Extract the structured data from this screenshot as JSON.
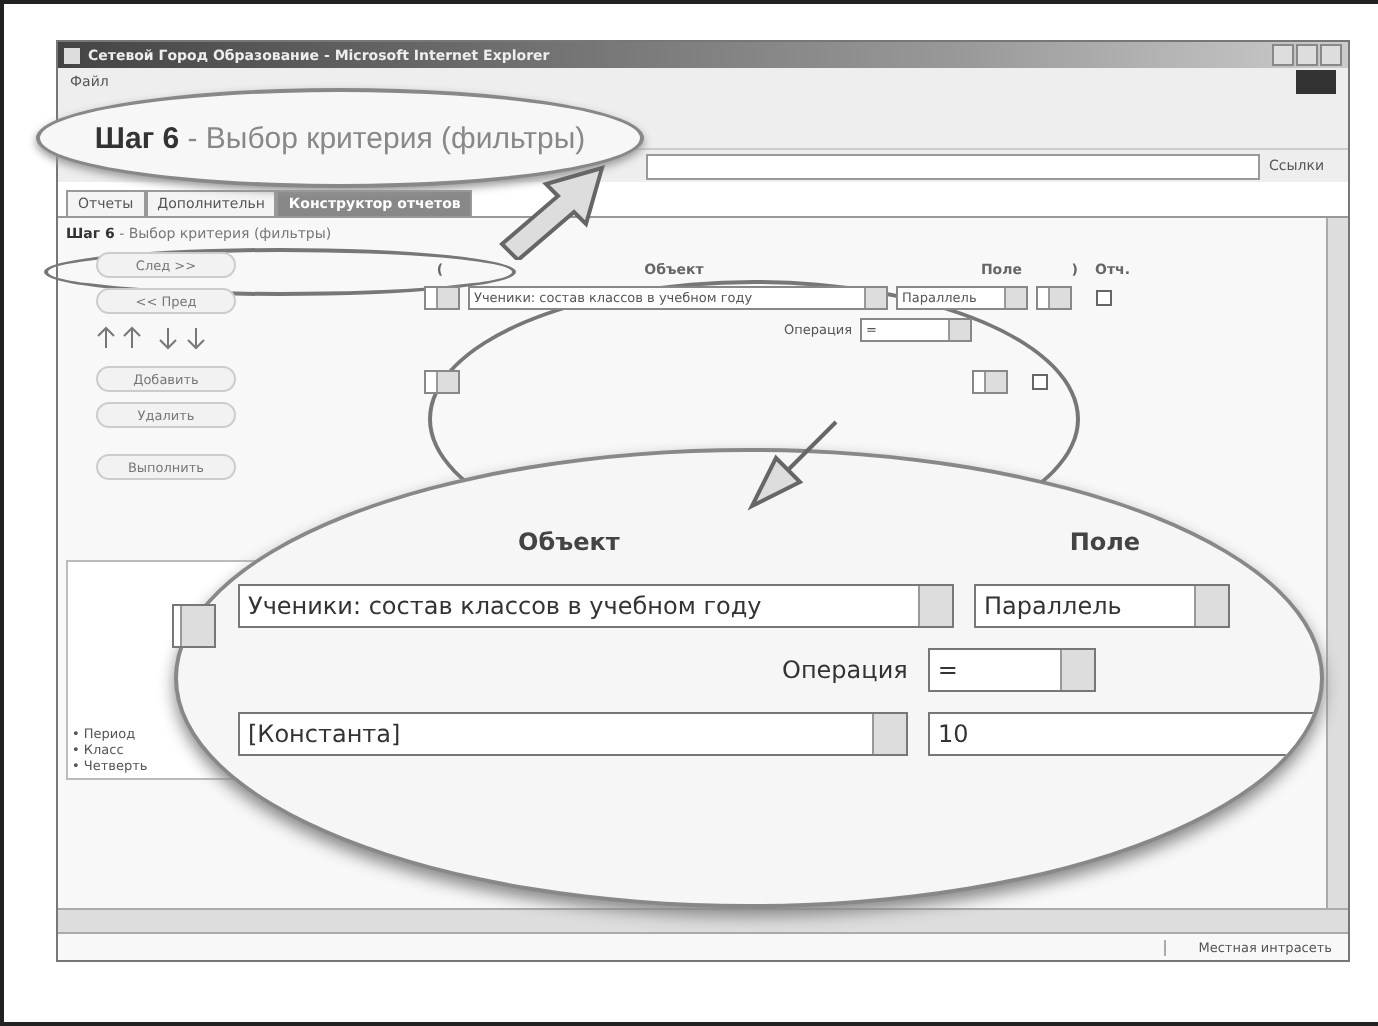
{
  "window": {
    "title": "Сетевой Город Образование - Microsoft Internet Explorer",
    "menu": [
      "Файл"
    ],
    "links_label": "Ссылки"
  },
  "tabs": [
    {
      "label": "Отчеты",
      "selected": false
    },
    {
      "label": "Дополнительн",
      "selected": false
    },
    {
      "label": "Конструктор отчетов",
      "selected": true
    }
  ],
  "step_heading": "**Шаг 6** - Выбор критерия (фильтры)",
  "nav_buttons": [
    "След >>",
    "<< Пред"
  ],
  "action_buttons": [
    "Добавить",
    "Удалить"
  ],
  "run_button": "Выполнить",
  "sidebar": {
    "items": [
      "• Период",
      "• Класс",
      "• Четверть"
    ]
  },
  "filter_table": {
    "columns": [
      "(",
      "Объект",
      "Поле",
      ")",
      "Отч."
    ],
    "rows": [
      {
        "object": "Ученики: состав классов в учебном году",
        "field": "Параллель",
        "report": false
      },
      {
        "report": false
      }
    ],
    "operation_label": "Операция",
    "operation": "="
  },
  "callout_heading": "**Шаг 6** - Выбор критерия (фильтры)",
  "magnifier": {
    "columns": [
      "Объект",
      "Поле"
    ],
    "object": "Ученики: состав классов в учебном году",
    "field": "Параллель",
    "operation_label": "Операция",
    "operation": "=",
    "value_source": "[Константа]",
    "value": "10"
  },
  "status_bar": {
    "zone": "Местная интрасеть"
  }
}
